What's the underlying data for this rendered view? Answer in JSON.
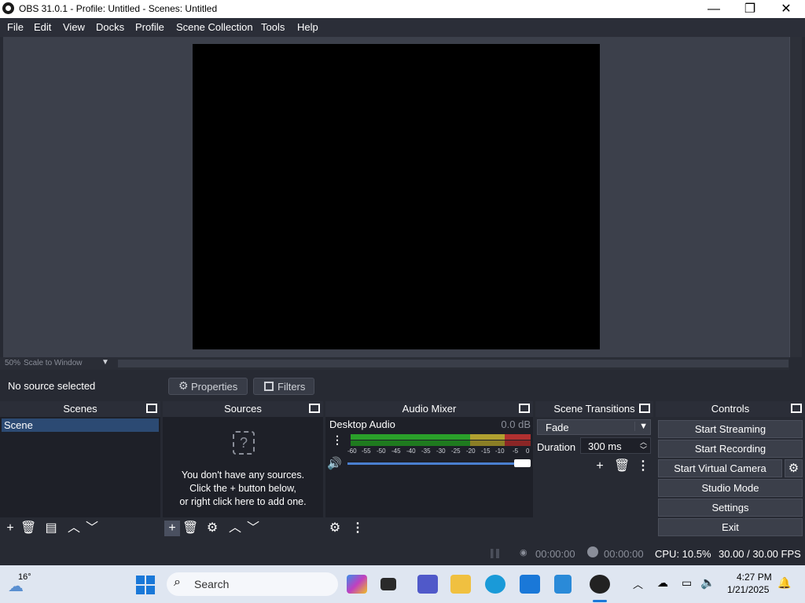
{
  "window": {
    "title": "OBS 31.0.1 - Profile: Untitled - Scenes: Untitled",
    "minimize": "—",
    "maximize": "❐",
    "close": "✕"
  },
  "menu": [
    "File",
    "Edit",
    "View",
    "Docks",
    "Profile",
    "Scene Collection",
    "Tools",
    "Help"
  ],
  "zoom": {
    "percent": "50%",
    "label": "Scale to Window"
  },
  "source_bar": {
    "status": "No source selected",
    "properties": "Properties",
    "filters": "Filters"
  },
  "docks": {
    "scenes": {
      "title": "Scenes",
      "items": [
        "Scene"
      ]
    },
    "sources": {
      "title": "Sources",
      "empty_line1": "You don't have any sources.",
      "empty_line2": "Click the + button below,",
      "empty_line3": "or right click here to add one."
    },
    "mixer": {
      "title": "Audio Mixer",
      "channel": "Desktop Audio",
      "level": "0.0 dB",
      "ticks": [
        "-60",
        "-55",
        "-50",
        "-45",
        "-40",
        "-35",
        "-30",
        "-25",
        "-20",
        "-15",
        "-10",
        "-5",
        "0"
      ],
      "colors": {
        "green": "#2aa02a",
        "yellow": "#b0a030",
        "red": "#b03030"
      }
    },
    "transitions": {
      "title": "Scene Transitions",
      "selected": "Fade",
      "duration_label": "Duration",
      "duration_value": "300 ms"
    },
    "controls": {
      "title": "Controls",
      "buttons": [
        "Start Streaming",
        "Start Recording",
        "Start Virtual Camera",
        "Studio Mode",
        "Settings",
        "Exit"
      ]
    }
  },
  "status": {
    "stream_time": "00:00:00",
    "record_time": "00:00:00",
    "cpu": "CPU: 10.5%",
    "fps": "30.00 / 30.00 FPS"
  },
  "taskbar": {
    "weather": "16°",
    "search": "Search",
    "time": "4:27 PM",
    "date": "1/21/2025"
  }
}
